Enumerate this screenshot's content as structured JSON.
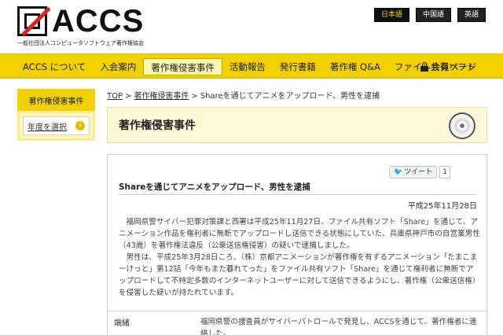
{
  "header": {
    "logo_text": "ACCS",
    "logo_subtitle": "一般社団法人コンピュータソフトウェア著作権協会",
    "languages": [
      "日本語",
      "中国語",
      "英語"
    ]
  },
  "nav": {
    "items": [
      "ACCS について",
      "入会案内",
      "著作権侵害事件",
      "活動報告",
      "発行書籍",
      "著作権 Q&A",
      "ファイル共有ソフト"
    ],
    "member": "会員ページ"
  },
  "sidebar": {
    "heading": "著作権侵害事件",
    "link": "年度を選択"
  },
  "breadcrumb": {
    "items": [
      "TOP",
      "著作権侵害事件",
      "Shareを通じてアニメをアップロード、男性を逮捕"
    ]
  },
  "page": {
    "title": "著作権侵害事件"
  },
  "article": {
    "tweet_label": "ツイート",
    "tweet_count": "1",
    "title": "Shareを通じてアニメをアップロード、男性を逮捕",
    "date": "平成25年11月28日",
    "paragraphs": [
      "福岡県警サイバー犯罪対策課と西署は平成25年11月27日、ファイル共有ソフト「Share」を通じて、アニメーション作品を権利者に無断でアップロードし送信できる状態にしていた、兵庫県神戸市の自営業男性（43歳）を著作権法違反（公衆送信権侵害）の疑いで逮捕しました。",
      "男性は、平成25年3月28日ころ、（株）京都アニメーションが著作権を有するアニメーション「たまこまーけっと」第12話「今年もまた暮れてった」をファイル共有ソフト「Share」を通じて権利者に無断でアップロードして不特定多数のインターネットユーザーに対して送信できるようにし、著作権（公衆送信権）を侵害した疑いが持たれています。"
    ],
    "info_label": "端緒",
    "info_value": "福岡県警の捜査員がサイバーパトロールで発見し、ACCSを通じて、著作権者に連絡した。"
  }
}
